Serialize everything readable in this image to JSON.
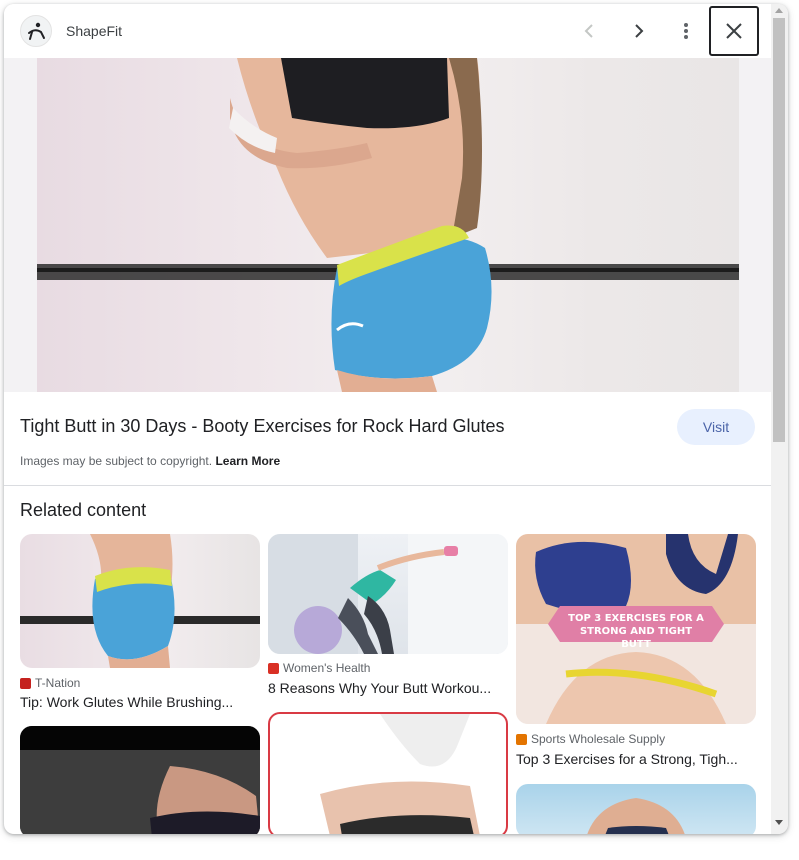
{
  "header": {
    "source_name": "ShapeFit",
    "icons": {
      "logo": "shapefit-logo-icon",
      "prev": "chevron-left-icon",
      "next": "chevron-right-icon",
      "more": "more-vert-icon",
      "close": "close-icon"
    }
  },
  "result": {
    "title": "Tight Butt in 30 Days - Booty Exercises for Rock Hard Glutes",
    "visit_label": "Visit",
    "copyright_text": "Images may be subject to copyright.",
    "learn_more_label": "Learn More"
  },
  "related": {
    "heading": "Related content",
    "cards": [
      {
        "source": "T-Nation",
        "title": "Tip: Work Glutes While Brushing...",
        "favicon_color": "#c5221f"
      },
      {
        "source": "Women's Health",
        "title": "8 Reasons Why Your Butt Workou...",
        "favicon_color": "#d93025"
      },
      {
        "source": "Sports Wholesale Supply",
        "title": "Top 3 Exercises for a Strong, Tigh...",
        "favicon_color": "#e37400",
        "banner_text": "TOP 3 EXERCISES FOR A STRONG AND TIGHT BUTT"
      },
      {
        "source": "",
        "title": ""
      },
      {
        "source": "",
        "title": ""
      },
      {
        "source": "",
        "title": ""
      }
    ]
  },
  "colors": {
    "visit_bg": "#e8f0fe",
    "visit_text": "#4a63a8",
    "shorts_blue": "#4aa3d8",
    "waistband_yellow": "#d9e24a",
    "banner_pink": "#e07fa6"
  }
}
